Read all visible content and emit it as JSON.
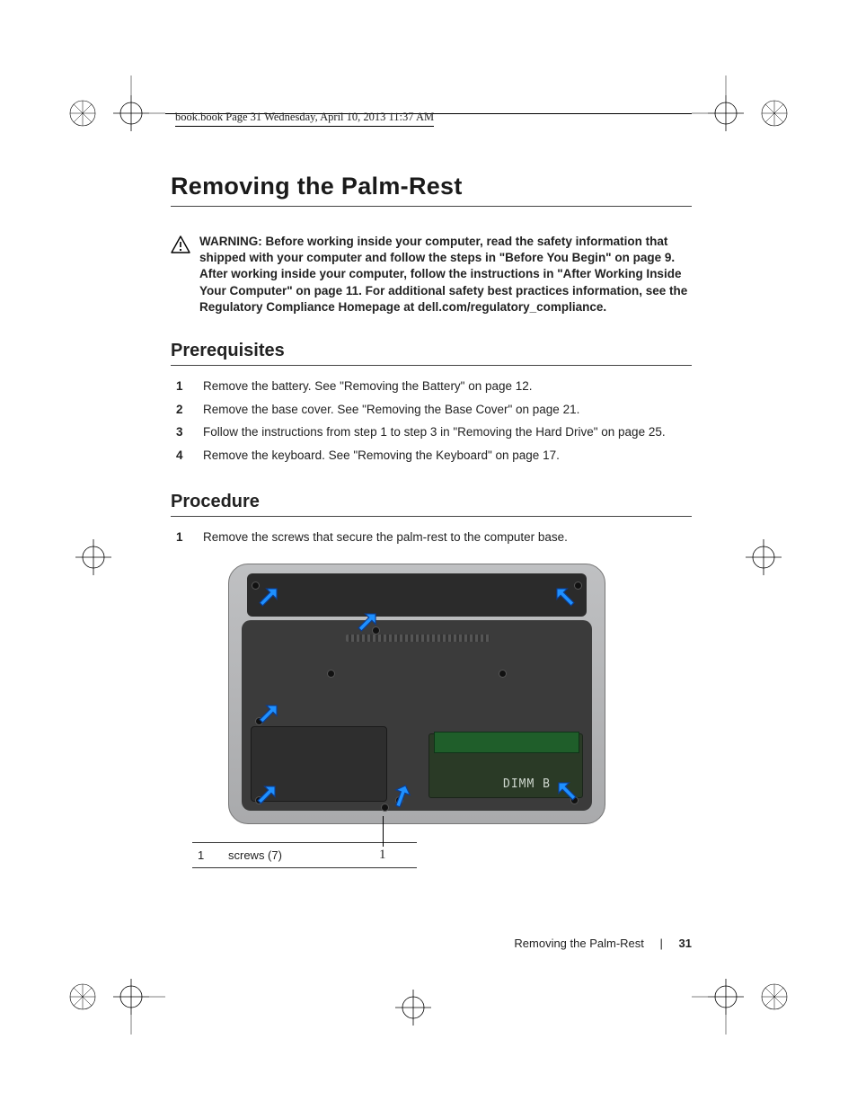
{
  "print_header": "book.book  Page 31  Wednesday, April 10, 2013  11:37 AM",
  "title": "Removing the Palm-Rest",
  "warning": {
    "label": "WARNING:  ",
    "text": "Before working inside your computer, read the safety information that shipped with your computer and follow the steps in \"Before You Begin\" on page 9. After working inside your computer, follow the instructions in \"After Working Inside Your Computer\" on page 11. For additional safety best practices information, see the Regulatory Compliance Homepage at dell.com/regulatory_compliance."
  },
  "sections": {
    "prerequisites": {
      "heading": "Prerequisites",
      "items": [
        "Remove the battery. See \"Removing the Battery\" on page 12.",
        "Remove the base cover. See \"Removing the Base Cover\" on page 21.",
        "Follow the instructions from step 1 to step 3 in \"Removing the Hard Drive\" on page 25.",
        "Remove the keyboard. See \"Removing the Keyboard\" on page 17."
      ]
    },
    "procedure": {
      "heading": "Procedure",
      "items": [
        "Remove the screws that secure the palm-rest to the computer base."
      ]
    }
  },
  "figure": {
    "dimm_label": "DIMM  B",
    "callout_num": "1",
    "arrow_count": 7
  },
  "legend": {
    "rows": [
      {
        "num": "1",
        "text": "screws (7)"
      }
    ]
  },
  "footer": {
    "section": "Removing the Palm-Rest",
    "page": "31"
  }
}
